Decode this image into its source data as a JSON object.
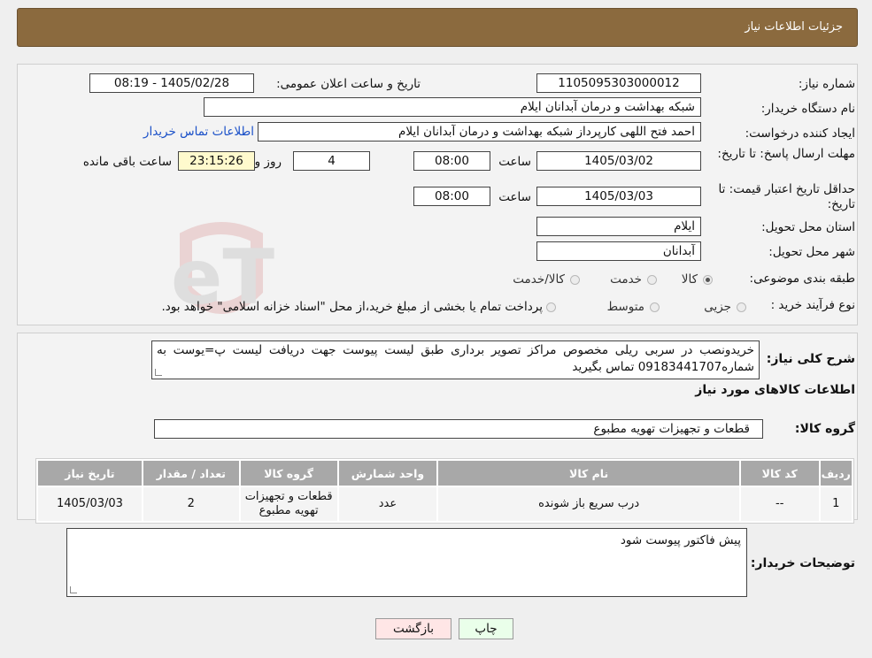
{
  "header": {
    "title": "جزئیات اطلاعات نیاز"
  },
  "watermark": {
    "text": "AriaTender.neT"
  },
  "info": {
    "need_number_label": "شماره نیاز:",
    "need_number": "1105095303000012",
    "announce_label": "تاریخ و ساعت اعلان عمومی:",
    "announce_value": "1405/02/28 - 08:19",
    "buyer_org_label": "نام دستگاه خریدار:",
    "buyer_org": "شبکه بهداشت و درمان آبدانان ایلام",
    "creator_label": "ایجاد کننده درخواست:",
    "creator": "احمد فتح اللهی کارپرداز شبکه بهداشت و درمان آبدانان ایلام",
    "contact_link": "اطلاعات تماس خریدار",
    "deadline_label": "مهلت ارسال پاسخ: تا تاریخ:",
    "deadline_date": "1405/03/02",
    "time_label": "ساعت",
    "deadline_time": "08:00",
    "days_remaining": "4",
    "days_label": "روز و",
    "remaining_time": "23:15:26",
    "remaining_label": "ساعت باقی مانده",
    "validity_label": "حداقل تاریخ اعتبار قیمت: تا تاریخ:",
    "validity_date": "1405/03/03",
    "validity_time": "08:00",
    "province_label": "استان محل تحویل:",
    "province": "ایلام",
    "city_label": "شهر محل تحویل:",
    "city": "آبدانان",
    "category_label": "طبقه بندی موضوعی:",
    "category_options": [
      "کالا",
      "خدمت",
      "کالا/خدمت"
    ],
    "category_selected": "کالا",
    "process_label": "نوع فرآیند خرید :",
    "process_options": [
      "جزیی",
      "متوسط"
    ],
    "process_note": "پرداخت تمام یا بخشی از مبلغ خرید،از محل \"اسناد خزانه اسلامی\" خواهد بود."
  },
  "description": {
    "label": "شرح کلی نیاز:",
    "text": "خریدونصب در سربی ریلی مخصوص مراکز تصویر برداری طبق لیست پیوست جهت دریافت لیست پ=یوست به شماره09183441707 تماس بگیرید"
  },
  "goods": {
    "section_title": "اطلاعات کالاهای مورد نیاز",
    "group_label": "گروه کالا:",
    "group_value": "قطعات و تجهیزات تهویه مطبوع"
  },
  "table": {
    "headers": [
      "ردیف",
      "کد کالا",
      "نام کالا",
      "واحد شمارش",
      "گروه کالا",
      "تعداد / مقدار",
      "تاریخ نیاز"
    ],
    "rows": [
      [
        "1",
        "--",
        "درب سریع باز شونده",
        "عدد",
        "قطعات و تجهیزات تهویه مطبوع",
        "2",
        "1405/03/03"
      ]
    ]
  },
  "buyer_notes": {
    "label": "توضیحات خریدار:",
    "text": "پیش فاکتور پیوست شود"
  },
  "buttons": {
    "print": "چاپ",
    "back": "بازگشت"
  },
  "colors": {
    "header_bg": "#8b6a3e",
    "link": "#1a50c8",
    "print_bg": "#eaffea",
    "back_bg": "#ffe6e6"
  }
}
